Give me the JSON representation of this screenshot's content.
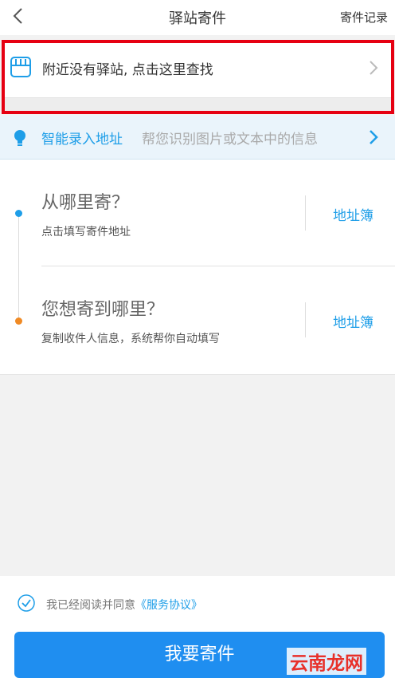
{
  "header": {
    "title": "驿站寄件",
    "record_label": "寄件记录",
    "back_icon": "chevron-left-icon"
  },
  "station": {
    "text": "附近没有驿站, 点击这里查找",
    "icon": "store-icon"
  },
  "smart": {
    "title": "智能录入地址",
    "subtitle": "帮您识别图片或文本中的信息",
    "icon": "lightbulb-icon"
  },
  "from": {
    "title": "从哪里寄？",
    "subtitle": "点击填写寄件地址",
    "book_label": "地址簿"
  },
  "to": {
    "title": "您想寄到哪里？",
    "subtitle": "复制收件人信息，系统帮你自动填写",
    "book_label": "地址簿"
  },
  "agreement": {
    "prefix": "我已经阅读并同意",
    "link": "《服务协议》",
    "checked": true
  },
  "submit_label": "我要寄件",
  "watermark": "云南龙网",
  "colors": {
    "accent": "#1e9ee8",
    "button": "#1f8ef0",
    "highlight": "#e60012",
    "from_dot": "#1e9ee8",
    "to_dot": "#f08a24"
  }
}
